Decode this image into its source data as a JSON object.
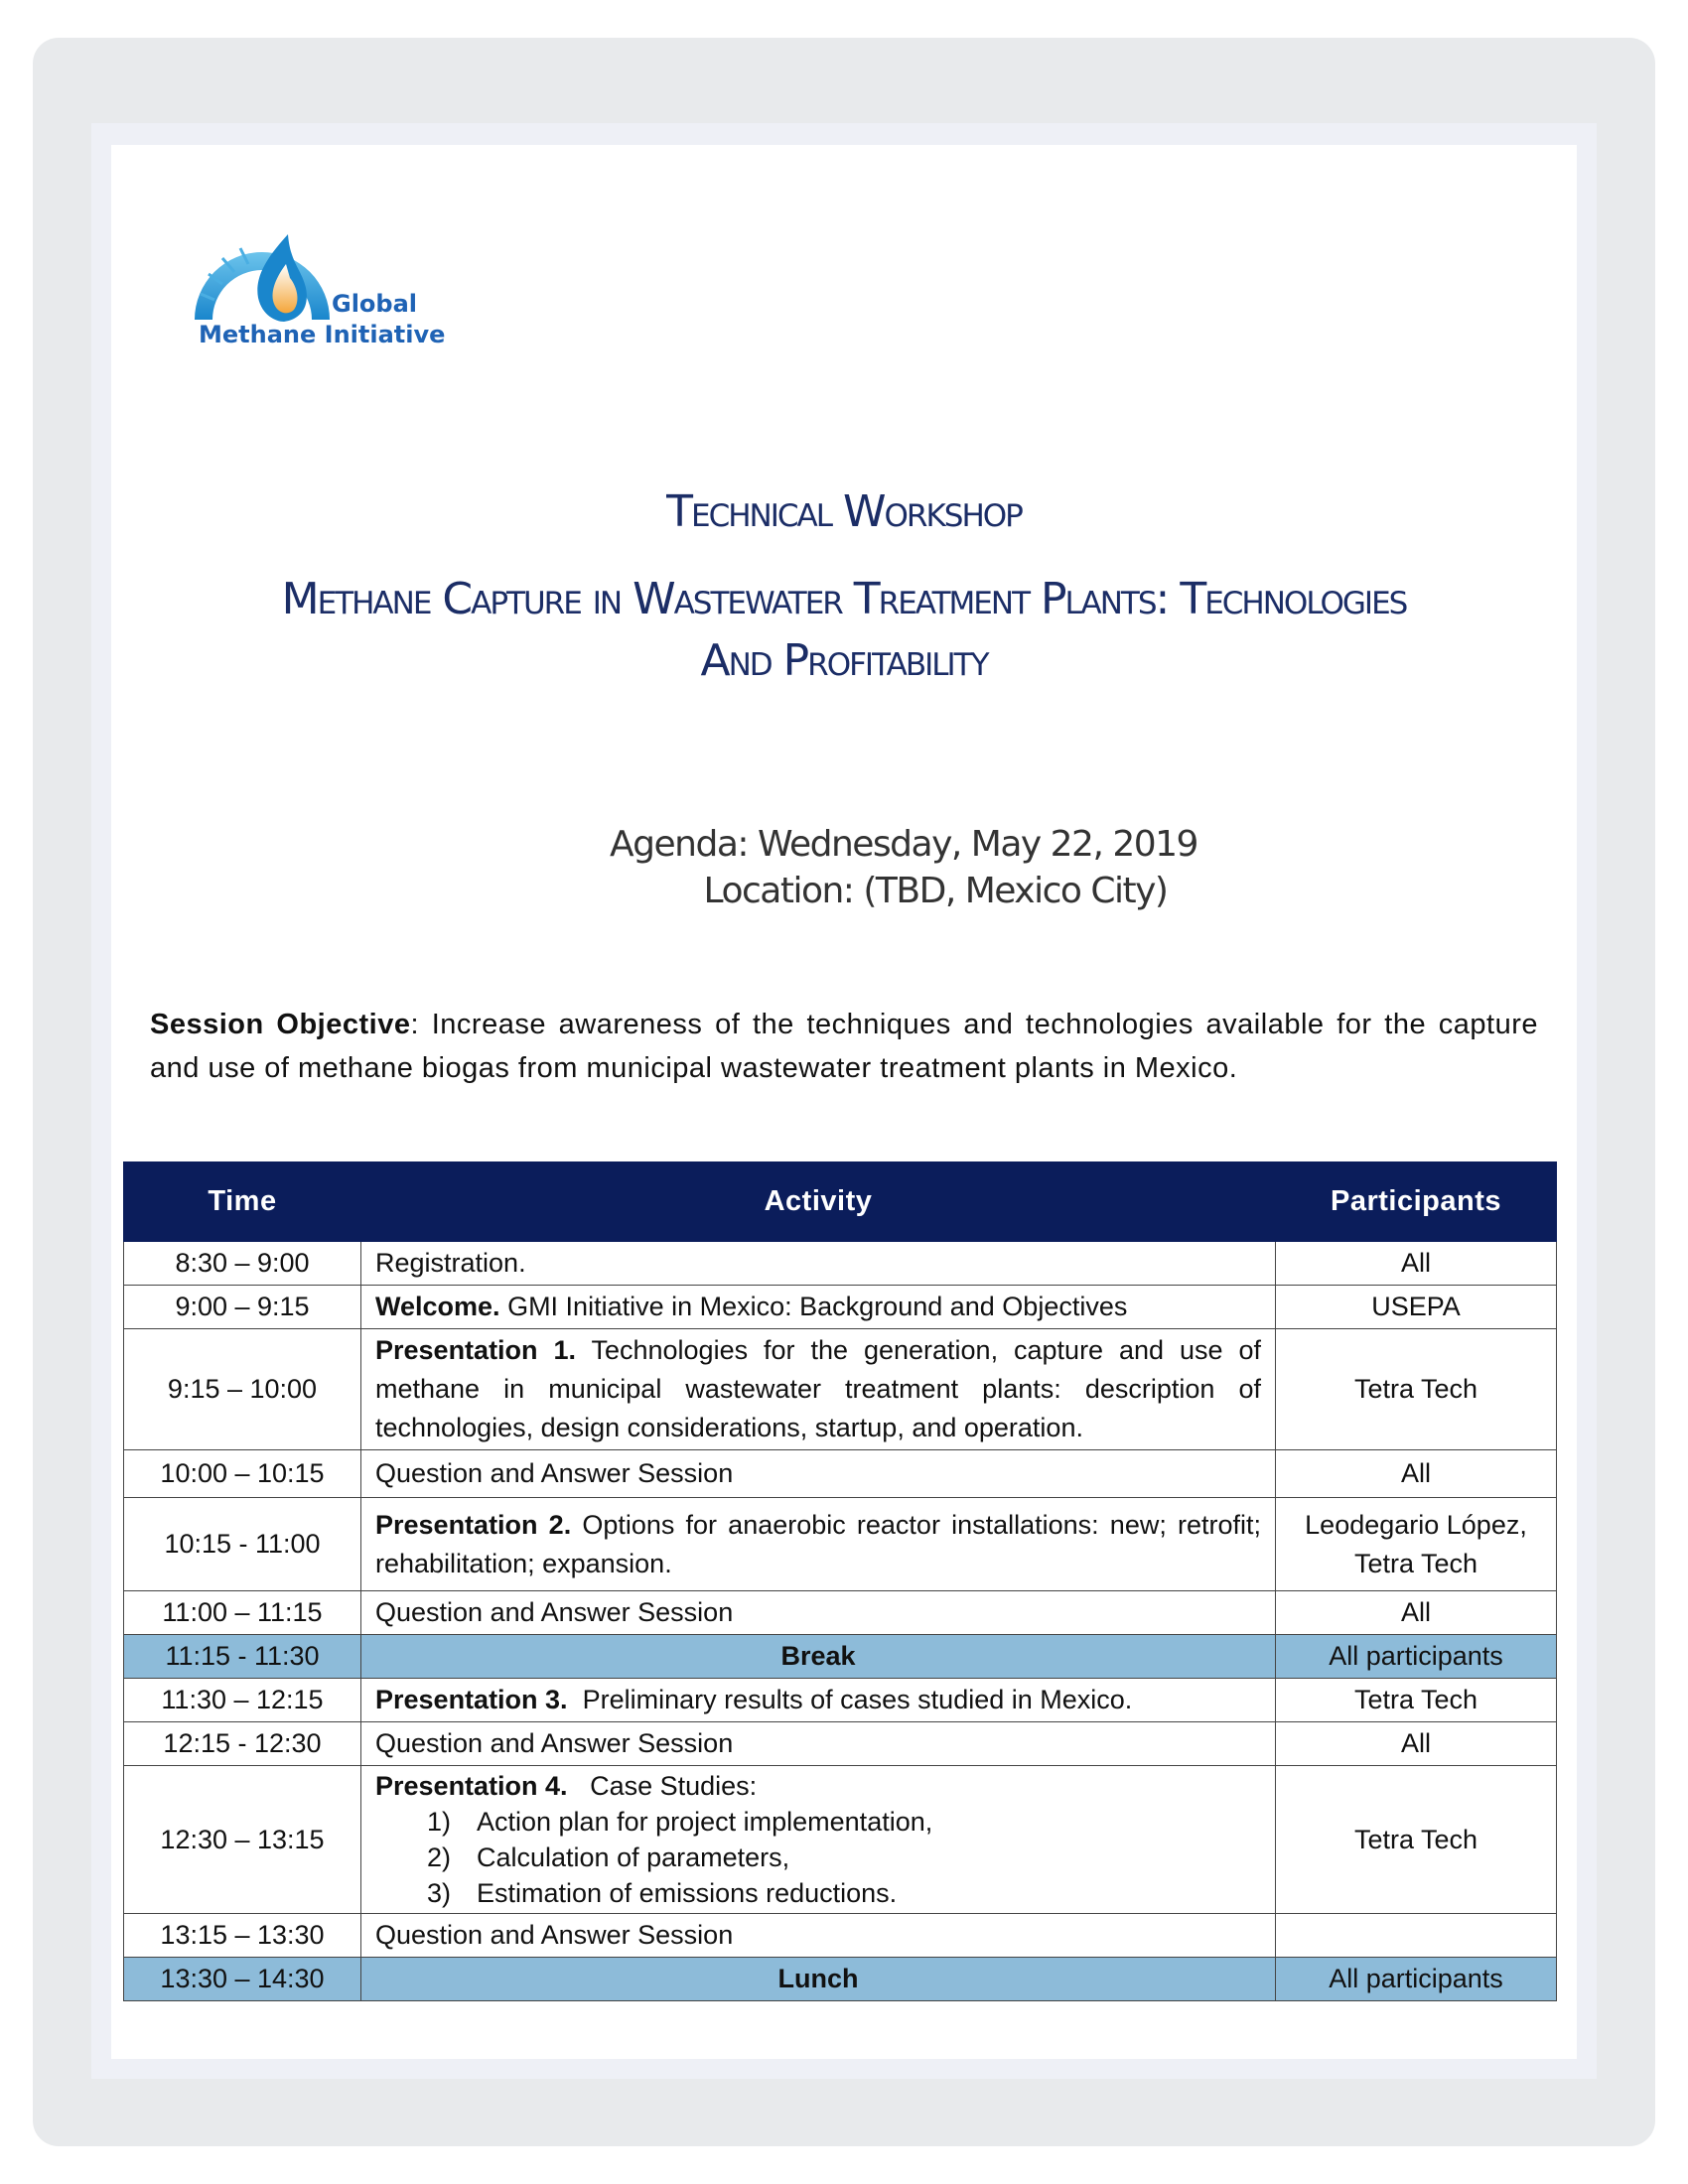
{
  "logo": {
    "line1": "Global",
    "line2": "Methane Initiative"
  },
  "title": {
    "line1": "Technical Workshop",
    "line2": "Methane Capture in Wastewater Treatment Plants: Technologies",
    "line3": "And Profitability"
  },
  "agenda": {
    "date": "Agenda: Wednesday, May 22, 2019",
    "location": "Location: (TBD, Mexico City)"
  },
  "objective": {
    "label": "Session Objective",
    "text": ": Increase awareness of the techniques and technologies available for the capture and use of methane biogas from municipal wastewater treatment plants in Mexico."
  },
  "table": {
    "headers": {
      "time": "Time",
      "activity": "Activity",
      "participants": "Participants"
    },
    "rows": [
      {
        "time": "8:30 – 9:00",
        "label": "",
        "activity": "Registration.",
        "participants": "All"
      },
      {
        "time": "9:00 – 9:15",
        "label": "Welcome.",
        "activity": " GMI Initiative in Mexico: Background and Objectives",
        "participants": "USEPA"
      },
      {
        "time": "9:15 – 10:00",
        "label": "Presentation 1.",
        "activity": " Technologies for the generation, capture and use of methane in municipal wastewater treatment plants: description of technologies, design considerations, startup, and operation.",
        "participants": "Tetra Tech"
      },
      {
        "time": "10:00 – 10:15",
        "label": "",
        "activity": "Question and Answer Session",
        "participants": "All"
      },
      {
        "time": "10:15 - 11:00",
        "label": "Presentation 2.",
        "activity": " Options for anaerobic reactor installations: new; retrofit; rehabilitation; expansion.",
        "participants": "Leodegario López,  Tetra Tech"
      },
      {
        "time": "11:00 – 11:15",
        "label": "",
        "activity": "Question and Answer Session",
        "participants": "All"
      },
      {
        "time": "11:15 - 11:30",
        "label": "",
        "activity": "Break",
        "participants": "All participants"
      },
      {
        "time": "11:30 – 12:15",
        "label": "Presentation 3.",
        "activity": "  Preliminary results of cases studied in Mexico.",
        "participants": "Tetra Tech"
      },
      {
        "time": "12:15 - 12:30",
        "label": "",
        "activity": "Question and Answer Session",
        "participants": "All"
      },
      {
        "time": "12:30 – 13:15",
        "label": "Presentation 4.",
        "activity": "   Case Studies:",
        "participants": "Tetra Tech",
        "items": [
          {
            "num": "1)",
            "text": "Action plan for project implementation,"
          },
          {
            "num": "2)",
            "text": "Calculation of parameters,"
          },
          {
            "num": "3)",
            "text": "Estimation of emissions reductions."
          }
        ]
      },
      {
        "time": "13:15 – 13:30",
        "label": "",
        "activity": "Question and Answer Session",
        "participants": ""
      },
      {
        "time": "13:30 – 14:30",
        "label": "",
        "activity": "Lunch",
        "participants": "All participants"
      }
    ]
  }
}
